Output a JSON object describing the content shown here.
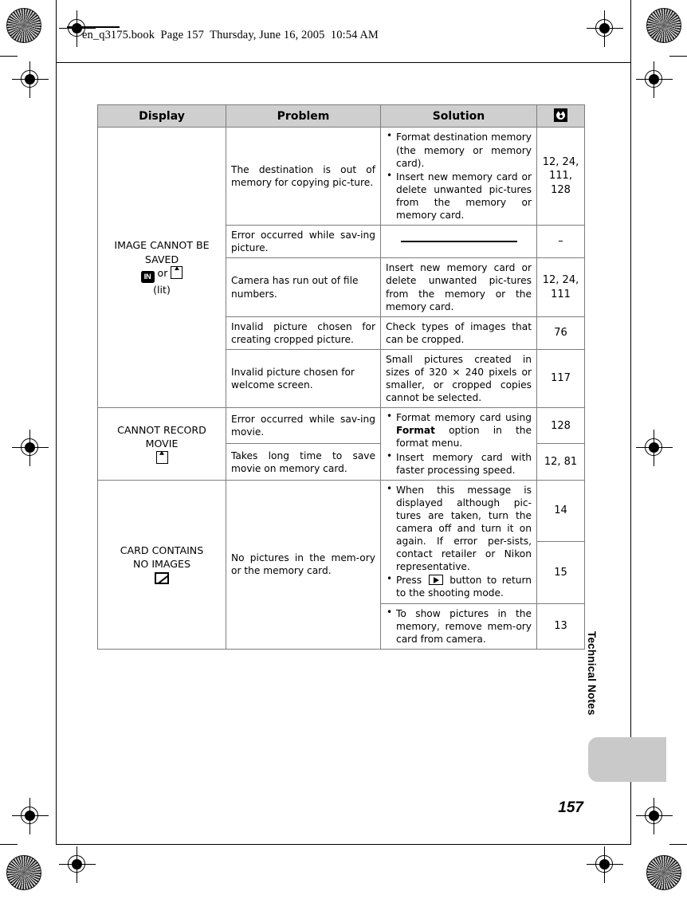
{
  "slug": {
    "text": "en_q3175.book  Page 157  Thursday, June 16, 2005  10:54 AM"
  },
  "side_tab": {
    "label": "Technical Notes"
  },
  "page_number": "157",
  "table": {
    "headers": {
      "display": "Display",
      "problem": "Problem",
      "solution": "Solution",
      "reference": "book-icon"
    },
    "groups": [
      {
        "display_text_line1": "IMAGE CANNOT BE",
        "display_text_line2": "SAVED",
        "display_icons": [
          "internal-memory-icon",
          "memory-card-icon"
        ],
        "display_icon_separator": "or",
        "display_note": "(lit)",
        "rows": [
          {
            "problem": "The destination is out of memory for copying pic-ture.",
            "solution_bullets": [
              "Format destination memory (the memory or memory card).",
              "Insert new memory card or delete unwanted pic-tures from the memory or memory card."
            ],
            "page": "12, 24, 111, 128"
          },
          {
            "problem": "Error occurred while sav-ing picture.",
            "solution_rule": true,
            "page": "–"
          },
          {
            "problem": "Camera has run out of file numbers.",
            "solution": "Insert new memory card or delete unwanted pic-tures from the memory or the memory card.",
            "page": "12, 24, 111"
          },
          {
            "problem": "Invalid picture chosen for creating cropped picture.",
            "solution": "Check types of images that can be cropped.",
            "page": "76"
          },
          {
            "problem": "Invalid picture chosen for welcome screen.",
            "solution": "Small pictures created in sizes of 320 × 240 pixels or smaller, or cropped copies cannot be selected.",
            "page": "117"
          }
        ]
      },
      {
        "display_text_line1": "CANNOT RECORD",
        "display_text_line2": "MOVIE",
        "display_icons": [
          "memory-card-icon"
        ],
        "rows": [
          {
            "problem": "Error occurred while sav-ing movie.",
            "solution_bullet_1_pre": "Format memory card using ",
            "solution_bullet_1_bold": "Format",
            "solution_bullet_1_post": " option in the format menu.",
            "solution_bullet_2": "Insert memory card with faster processing speed.",
            "page_1": "128",
            "page_2": "12, 81"
          },
          {
            "problem": "Takes long time to save movie on memory card."
          }
        ]
      },
      {
        "display_text_line1": "CARD CONTAINS",
        "display_text_line2": "NO IMAGES",
        "display_icons": [
          "no-image-icon"
        ],
        "rows": [
          {
            "problem": "No pictures in the mem-ory or the memory card.",
            "solution_bullet_1_pre": "When this message is displayed although pic-tures are taken, turn the camera off and turn it on again. If error per-sists, contact retailer or Nikon representative.",
            "solution_bullet_2_pre": "Press ",
            "solution_bullet_2_icon": "playback-button-icon",
            "solution_bullet_2_post": " button to return to the shooting mode.",
            "page_1": "14",
            "page_2": "15",
            "solution_bullet_3": "To show pictures in the memory, remove mem-ory card from camera.",
            "page_3": "13"
          }
        ]
      }
    ]
  }
}
